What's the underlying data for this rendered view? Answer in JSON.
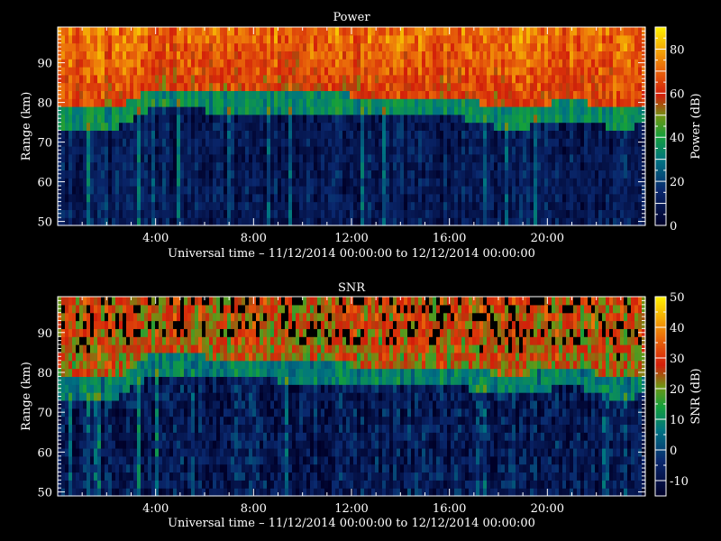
{
  "chart_data": [
    {
      "type": "heatmap",
      "title": "Power",
      "xlabel": "Universal time – 11/12/2014 00:00:00 to 12/12/2014 00:00:00",
      "ylabel": "Range (km)",
      "colorbar_label": "Power (dB)",
      "xlim_hours": [
        0,
        24
      ],
      "ylim": [
        49,
        99
      ],
      "x_ticks": [
        "4:00",
        "8:00",
        "12:00",
        "16:00",
        "20:00"
      ],
      "x_tick_hours": [
        4,
        8,
        12,
        16,
        20
      ],
      "y_ticks": [
        50,
        60,
        70,
        80,
        90
      ],
      "colorbar_range": [
        0,
        90
      ],
      "colorbar_ticks": [
        0,
        20,
        40,
        60,
        80
      ],
      "profile": {
        "hours": [
          0,
          2.5,
          4,
          6,
          12,
          16,
          18.5,
          21,
          23,
          24
        ],
        "transition_km": [
          76,
          76,
          81,
          80,
          79,
          79,
          75,
          78,
          75,
          77
        ]
      },
      "levels_db": {
        "below": 10,
        "transition": 35,
        "above": 62,
        "top": 80
      }
    },
    {
      "type": "heatmap",
      "title": "SNR",
      "xlabel": "Universal time – 11/12/2014 00:00:00 to 12/12/2014 00:00:00",
      "ylabel": "Range (km)",
      "colorbar_label": "SNR (dB)",
      "xlim_hours": [
        0,
        24
      ],
      "ylim": [
        49,
        99
      ],
      "x_ticks": [
        "4:00",
        "8:00",
        "12:00",
        "16:00",
        "20:00"
      ],
      "x_tick_hours": [
        4,
        8,
        12,
        16,
        20
      ],
      "y_ticks": [
        50,
        60,
        70,
        80,
        90
      ],
      "colorbar_range": [
        -15,
        50
      ],
      "colorbar_ticks": [
        -10,
        0,
        10,
        20,
        30,
        40,
        50
      ],
      "profile": {
        "hours": [
          0,
          2.5,
          4,
          6,
          12,
          16,
          18.5,
          21,
          23,
          24
        ],
        "transition_km": [
          76,
          76,
          82,
          81,
          79,
          79,
          76,
          79,
          75,
          77
        ]
      },
      "levels_db": {
        "below": -8,
        "transition": 8,
        "above": 24,
        "top": 30
      }
    }
  ]
}
